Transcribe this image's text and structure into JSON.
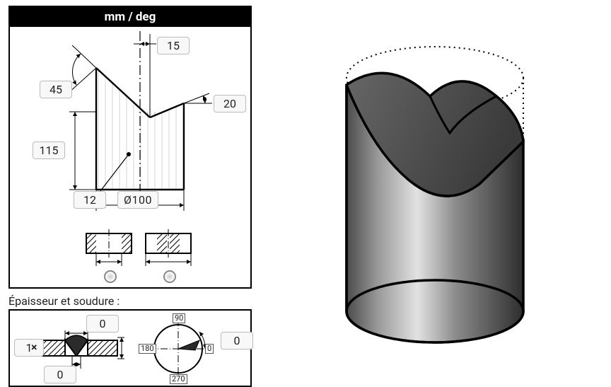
{
  "header": {
    "units": "mm / deg"
  },
  "dimensions": {
    "angle_left": "45",
    "angle_right": "20",
    "apex_offset": "15",
    "height": "115",
    "wall": "12",
    "diameter": "Ø100"
  },
  "end_options": {
    "outer_first": true,
    "inner_first": true
  },
  "section_label": "Épaisseur et soudure :",
  "weld": {
    "thickness": "1",
    "root_gap_top": "0",
    "root_gap_bottom": "0",
    "bevel_angle": "0",
    "ticks": {
      "n": "90",
      "e": "0",
      "s": "270",
      "w": "180"
    }
  },
  "chart_data": {
    "type": "engineering-drawing",
    "shape": "truncated_cylinder",
    "diameter_mm": 100,
    "wall_thickness_mm": 12,
    "body_height_mm": 115,
    "cut_angle_left_deg": 45,
    "cut_angle_right_deg": 20,
    "apex_offset_from_axis_mm": 15,
    "apex_side": "right_of_axis",
    "weld_thickness": 1,
    "weld_root_gap_top": 0,
    "weld_root_gap_bottom": 0,
    "weld_index_angle_deg": 0,
    "weld_index_ticks_deg": [
      0,
      90,
      180,
      270
    ]
  }
}
